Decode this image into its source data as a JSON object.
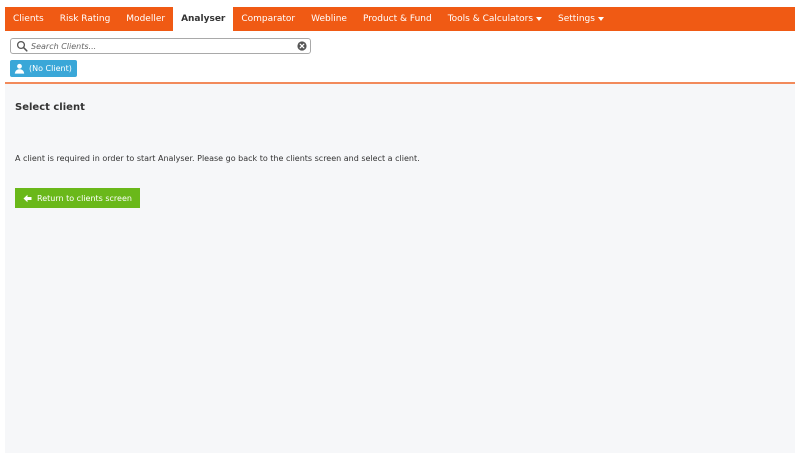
{
  "nav": {
    "items": [
      {
        "label": "Clients",
        "active": false,
        "dropdown": false
      },
      {
        "label": "Risk Rating",
        "active": false,
        "dropdown": false
      },
      {
        "label": "Modeller",
        "active": false,
        "dropdown": false
      },
      {
        "label": "Analyser",
        "active": true,
        "dropdown": false
      },
      {
        "label": "Comparator",
        "active": false,
        "dropdown": false
      },
      {
        "label": "Webline",
        "active": false,
        "dropdown": false
      },
      {
        "label": "Product & Fund",
        "active": false,
        "dropdown": false
      },
      {
        "label": "Tools & Calculators",
        "active": false,
        "dropdown": true
      },
      {
        "label": "Settings",
        "active": false,
        "dropdown": true
      }
    ]
  },
  "search": {
    "placeholder": "Search Clients...",
    "value": ""
  },
  "client_chip": {
    "label": "(No Client)"
  },
  "main": {
    "title": "Select client",
    "message": "A client is required in order to start Analyser. Please go back to the clients screen and select a client.",
    "return_button": "Return to clients screen"
  },
  "colors": {
    "nav_bg": "#f05a14",
    "chip_bg": "#3aa7d8",
    "button_bg": "#6ab81a",
    "content_bg": "#f6f7f9"
  },
  "icons": {
    "search": "search-icon",
    "clear": "clear-icon",
    "user": "user-icon",
    "return": "arrow-left-icon",
    "dropdown": "caret-down-icon"
  }
}
